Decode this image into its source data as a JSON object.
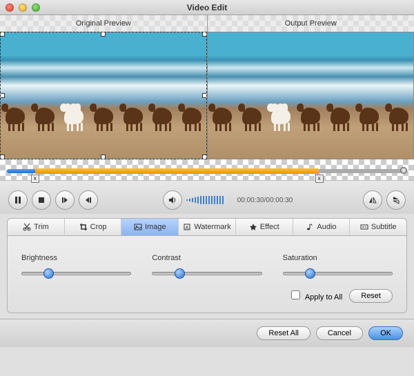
{
  "window": {
    "title": "Video Edit"
  },
  "previews": {
    "original_label": "Original Preview",
    "output_label": "Output Preview"
  },
  "timeline": {
    "marker_in": "x",
    "marker_out": "x"
  },
  "playback": {
    "timecode": "00:00:30/00:00:30"
  },
  "tabs": [
    {
      "id": "trim",
      "label": "Trim"
    },
    {
      "id": "crop",
      "label": "Crop"
    },
    {
      "id": "image",
      "label": "Image"
    },
    {
      "id": "watermark",
      "label": "Watermark"
    },
    {
      "id": "effect",
      "label": "Effect"
    },
    {
      "id": "audio",
      "label": "Audio"
    },
    {
      "id": "subtitle",
      "label": "Subtitle"
    }
  ],
  "sliders": {
    "brightness": {
      "label": "Brightness",
      "value": 20
    },
    "contrast": {
      "label": "Contrast",
      "value": 20
    },
    "saturation": {
      "label": "Saturation",
      "value": 20
    }
  },
  "apply_all_label": "Apply to All",
  "buttons": {
    "reset": "Reset",
    "reset_all": "Reset All",
    "cancel": "Cancel",
    "ok": "OK"
  }
}
